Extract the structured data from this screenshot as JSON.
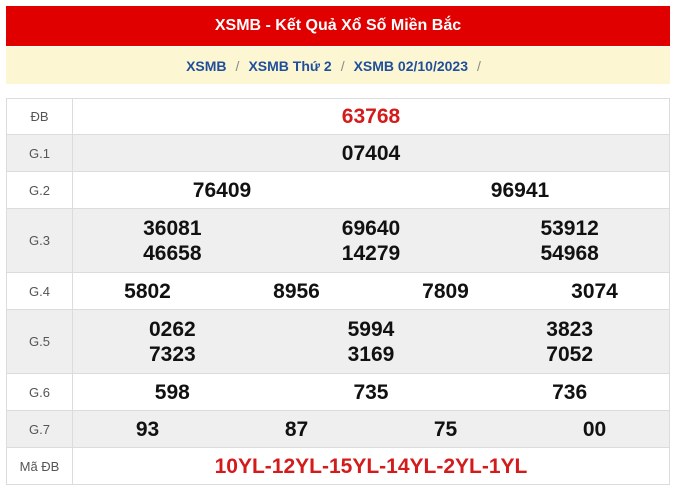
{
  "header": {
    "title": "XSMB - Kết Quả Xổ Số Miền Bắc"
  },
  "breadcrumb": {
    "items": [
      "XSMB",
      "XSMB Thứ 2",
      "XSMB 02/10/2023"
    ],
    "separator": "/"
  },
  "prizes": [
    {
      "label": "ĐB",
      "columns": 1,
      "numbers": [
        "63768"
      ],
      "highlight": true
    },
    {
      "label": "G.1",
      "columns": 1,
      "numbers": [
        "07404"
      ]
    },
    {
      "label": "G.2",
      "columns": 2,
      "numbers": [
        "76409",
        "96941"
      ]
    },
    {
      "label": "G.3",
      "columns": 3,
      "numbers": [
        "36081",
        "69640",
        "53912",
        "46658",
        "14279",
        "54968"
      ]
    },
    {
      "label": "G.4",
      "columns": 4,
      "numbers": [
        "5802",
        "8956",
        "7809",
        "3074"
      ]
    },
    {
      "label": "G.5",
      "columns": 3,
      "numbers": [
        "0262",
        "5994",
        "3823",
        "7323",
        "3169",
        "7052"
      ]
    },
    {
      "label": "G.6",
      "columns": 3,
      "numbers": [
        "598",
        "735",
        "736"
      ]
    },
    {
      "label": "G.7",
      "columns": 4,
      "numbers": [
        "93",
        "87",
        "75",
        "00"
      ]
    },
    {
      "label": "Mã ĐB",
      "columns": 1,
      "numbers": [
        "10YL-12YL-15YL-14YL-2YL-1YL"
      ],
      "highlight": true
    }
  ],
  "colors": {
    "header_bg": "#e10000",
    "breadcrumb_bg": "#fdf6d3",
    "link": "#1f4f9a",
    "highlight": "#d31b1b",
    "alt_row": "#efefef"
  }
}
